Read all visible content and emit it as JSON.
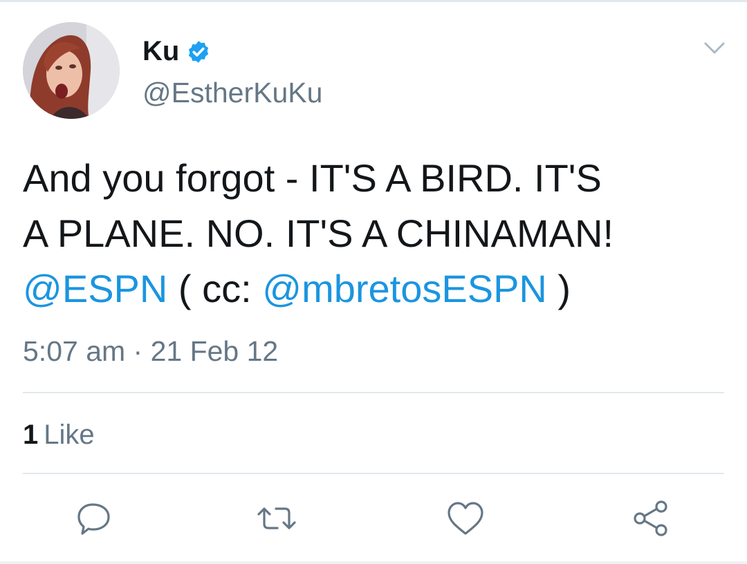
{
  "author": {
    "display_name": "Ku",
    "handle": "@EstherKuKu",
    "verified": true
  },
  "tweet": {
    "text_line1": "And you forgot - IT'S A BIRD. IT'S",
    "text_line2": "A PLANE. NO. IT'S A CHINAMAN!",
    "mention_1": "@ESPN",
    "between_mentions": " ( cc: ",
    "mention_2": "@mbretosESPN",
    "trailing": " )",
    "time": "5:07 am",
    "separator": " · ",
    "date": "21 Feb 12"
  },
  "engagement": {
    "like_count": "1",
    "like_label": "Like"
  },
  "actions": [
    {
      "icon": "reply-icon"
    },
    {
      "icon": "retweet-icon"
    },
    {
      "icon": "heart-icon"
    },
    {
      "icon": "share-icon"
    }
  ],
  "colors": {
    "link": "#1b95e0",
    "text": "#14171a",
    "secondary": "#657786",
    "verified": "#1da1f2",
    "divider": "#e1e8ed"
  }
}
